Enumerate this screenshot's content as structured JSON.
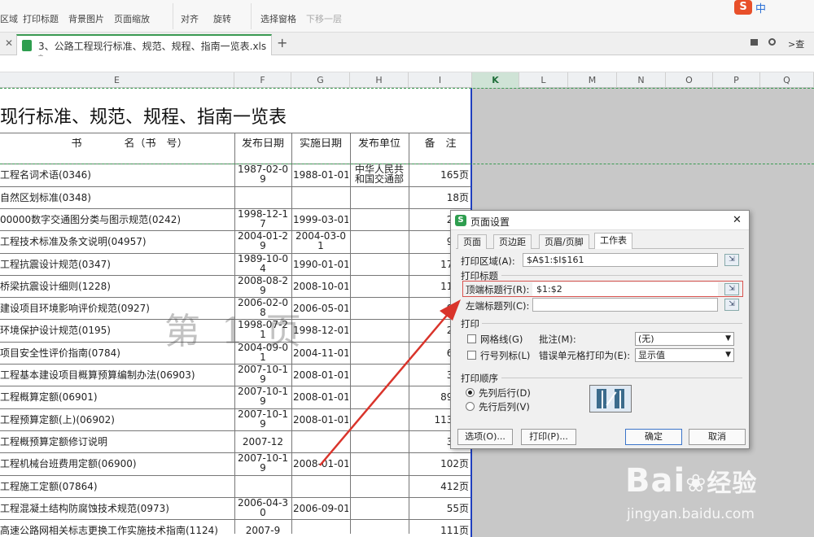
{
  "toolbar": {
    "items": [
      "区域",
      "打印标题",
      "背景图片",
      "页面缩放",
      "对齐",
      "旋转",
      "选择窗格",
      "下移一层"
    ],
    "top_right_text": "中",
    "right_label": ">查"
  },
  "tabbar": {
    "file_tab": "3、公路工程现行标准、规范、规程、指南一览表.xls *",
    "add": "+"
  },
  "sheet": {
    "columns": [
      "E",
      "F",
      "G",
      "H",
      "I",
      "K",
      "L",
      "M",
      "N",
      "O",
      "P",
      "Q"
    ],
    "selected_column": "K",
    "title": "现行标准、规范、规程、指南一览表",
    "headers": [
      "书　　　　名（书　号）",
      "发布日期",
      "实施日期",
      "发布单位",
      "备　注"
    ],
    "rows": [
      {
        "name": "工程名词术语(0346)",
        "pub": "1987-02-09",
        "impl": "1988-01-01",
        "unit": "中华人民共和国交通部",
        "note": "165页"
      },
      {
        "name": "自然区划标准(0348)",
        "pub": "",
        "impl": "",
        "unit": "",
        "note": "18页"
      },
      {
        "name": "00000数字交通图分类与图示规范(0242)",
        "pub": "1998-12-17",
        "impl": "1999-03-01",
        "unit": "",
        "note": "24页"
      },
      {
        "name": "工程技术标准及条文说明(04957)",
        "pub": "2004-01-29",
        "impl": "2004-03-01",
        "unit": "",
        "note": "92页"
      },
      {
        "name": "工程抗震设计规范(0347)",
        "pub": "1989-10-04",
        "impl": "1990-01-01",
        "unit": "",
        "note": "176页"
      },
      {
        "name": "桥梁抗震设计细则(1228)",
        "pub": "2008-08-29",
        "impl": "2008-10-01",
        "unit": "",
        "note": "112页"
      },
      {
        "name": "建设项目环境影响评价规范(0927)",
        "pub": "2006-02-08",
        "impl": "2006-05-01",
        "unit": "",
        "note": "91页"
      },
      {
        "name": "环境保护设计规范(0195)",
        "pub": "1998-07-21",
        "impl": "1998-12-01",
        "unit": "",
        "note": "24页"
      },
      {
        "name": "项目安全性评价指南(0784)",
        "pub": "2004-09-01",
        "impl": "2004-11-01",
        "unit": "",
        "note": "65页"
      },
      {
        "name": "工程基本建设项目概算预算编制办法(06903)",
        "pub": "2007-10-19",
        "impl": "2008-01-01",
        "unit": "",
        "note": "38页"
      },
      {
        "name": "工程概算定额(06901)",
        "pub": "2007-10-19",
        "impl": "2008-01-01",
        "unit": "",
        "note": "899页"
      },
      {
        "name": "工程预算定额(上)(06902)",
        "pub": "2007-10-19",
        "impl": "2008-01-01",
        "unit": "",
        "note": "1133页"
      },
      {
        "name": "工程概预算定额修订说明",
        "pub": "2007-12",
        "impl": "",
        "unit": "",
        "note": "32页"
      },
      {
        "name": "工程机械台班费用定额(06900)",
        "pub": "2007-10-19",
        "impl": "2008-01-01",
        "unit": "",
        "note": "102页"
      },
      {
        "name": "工程施工定额(07864)",
        "pub": "",
        "impl": "",
        "unit": "",
        "note": "412页"
      },
      {
        "name": "工程混凝土结构防腐蚀技术规范(0973)",
        "pub": "2006-04-30",
        "impl": "2006-09-01",
        "unit": "",
        "note": "55页"
      },
      {
        "name": "高速公路网相关标志更换工作实施技术指南(1124)",
        "pub": "2007-9",
        "impl": "",
        "unit": "",
        "note": "111页"
      }
    ],
    "page_watermark": "第 1 页"
  },
  "dialog": {
    "title": "页面设置",
    "close": "✕",
    "tabs": [
      "页面",
      "页边距",
      "页眉/页脚",
      "工作表"
    ],
    "active_tab": "工作表",
    "print_area_label": "打印区域(A):",
    "print_area_value": "$A$1:$I$161",
    "print_titles_group": "打印标题",
    "top_rows_label": "顶端标题行(R):",
    "top_rows_value": "$1:$2",
    "left_cols_label": "左端标题列(C):",
    "left_cols_value": "",
    "print_group": "打印",
    "gridlines_label": "网格线(G)",
    "comments_label": "批注(M):",
    "comments_value": "(无)",
    "rowcol_label": "行号列标(L)",
    "errors_label": "错误单元格打印为(E):",
    "errors_value": "显示值",
    "order_group": "打印顺序",
    "order_down": "先列后行(D)",
    "order_over": "先行后列(V)",
    "options_btn": "选项(O)...",
    "print_btn": "打印(P)...",
    "ok_btn": "确定",
    "cancel_btn": "取消"
  },
  "watermark": {
    "brand": "Bai",
    "brand2": "经验",
    "url": "jingyan.baidu.com"
  },
  "colors": {
    "accent_green": "#2e9e4f",
    "arrow_red": "#d9342b",
    "page_break_blue": "#1f3fbf"
  }
}
